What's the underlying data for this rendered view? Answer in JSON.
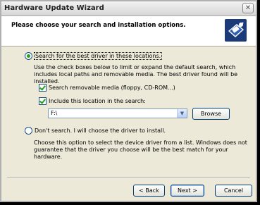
{
  "window": {
    "title": "Hardware Update Wizard",
    "close_glyph": "✕"
  },
  "header": {
    "title": "Please choose your search and installation options.",
    "icon": "hardware-wizard-icon"
  },
  "option_search": {
    "label": "Search for the best driver in these locations.",
    "selected": true,
    "description": "Use the check boxes below to limit or expand the default search, which includes local paths and removable media. The best driver found will be installed.",
    "removable_media": {
      "label": "Search removable media (floppy, CD-ROM...)",
      "checked": true
    },
    "include_location": {
      "label": "Include this location in the search:",
      "checked": true
    },
    "location_value": "F:\\",
    "dropdown_glyph": "▼",
    "browse_label": "Browse"
  },
  "option_manual": {
    "label": "Don't search. I will choose the driver to install.",
    "selected": false,
    "description": "Choose this option to select the device driver from a list. Windows does not guarantee that the driver you choose will be the best match for your hardware."
  },
  "footer": {
    "back_label": "< Back",
    "next_label": "Next >",
    "cancel_label": "Cancel"
  },
  "colors": {
    "window_bg": "#ece9d8",
    "radio_fill": "#21a121",
    "button_border": "#003c74"
  }
}
